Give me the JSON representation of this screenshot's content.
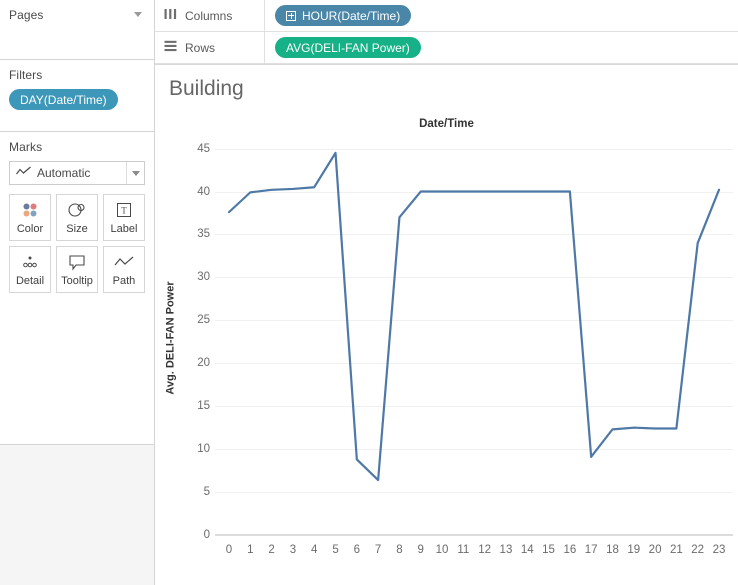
{
  "pages": {
    "title": "Pages",
    "dropdown_icon": "chevron-down-icon"
  },
  "filters": {
    "title": "Filters",
    "pills": [
      {
        "label": "DAY(Date/Time)",
        "color": "#3d97b8"
      }
    ]
  },
  "marks": {
    "title": "Marks",
    "mark_type": "Automatic",
    "mark_type_icon": "line-chart-icon",
    "dropdown_icon": "chevron-down-icon",
    "buttons": [
      {
        "label": "Color",
        "icon": "color-dots-icon"
      },
      {
        "label": "Size",
        "icon": "size-circles-icon"
      },
      {
        "label": "Label",
        "icon": "label-text-icon"
      },
      {
        "label": "Detail",
        "icon": "detail-dots-icon"
      },
      {
        "label": "Tooltip",
        "icon": "tooltip-bubble-icon"
      },
      {
        "label": "Path",
        "icon": "path-line-icon"
      }
    ]
  },
  "shelves": [
    {
      "name": "Columns",
      "icon": "columns-icon",
      "pill": {
        "label": "HOUR(Date/Time)",
        "color": "#4a86a8",
        "has_plus": true
      }
    },
    {
      "name": "Rows",
      "icon": "rows-icon",
      "pill": {
        "label": "AVG(DELI-FAN Power)",
        "color": "#16b187",
        "has_plus": false
      }
    }
  ],
  "view": {
    "title": "Building"
  },
  "chart_data": {
    "type": "line",
    "title": "Building",
    "xlabel": "Date/Time",
    "ylabel": "Avg. DELI-FAN Power",
    "x": [
      0,
      1,
      2,
      3,
      4,
      5,
      6,
      7,
      8,
      9,
      10,
      11,
      12,
      13,
      14,
      15,
      16,
      17,
      18,
      19,
      20,
      21,
      22,
      23
    ],
    "xticklabels": [
      "0",
      "1",
      "2",
      "3",
      "4",
      "5",
      "6",
      "7",
      "8",
      "9",
      "10",
      "11",
      "12",
      "13",
      "14",
      "15",
      "16",
      "17",
      "18",
      "19",
      "20",
      "21",
      "22",
      "23"
    ],
    "values": [
      37.6,
      39.9,
      40.2,
      40.3,
      40.5,
      44.5,
      8.8,
      6.4,
      37.0,
      40.0,
      40.0,
      40.0,
      40.0,
      40.0,
      40.0,
      40.0,
      40.0,
      9.1,
      12.3,
      12.5,
      12.4,
      12.4,
      34.0,
      40.2
    ],
    "ylim": [
      0,
      46
    ],
    "yticks": [
      0,
      5,
      10,
      15,
      20,
      25,
      30,
      35,
      40,
      45
    ],
    "yticklabels": [
      "0",
      "5",
      "10",
      "15",
      "20",
      "25",
      "30",
      "35",
      "40",
      "45"
    ],
    "xlim": [
      0,
      23
    ],
    "grid": true,
    "legend": "none",
    "line_color": "#4e79a7",
    "line_width": 2.2
  }
}
